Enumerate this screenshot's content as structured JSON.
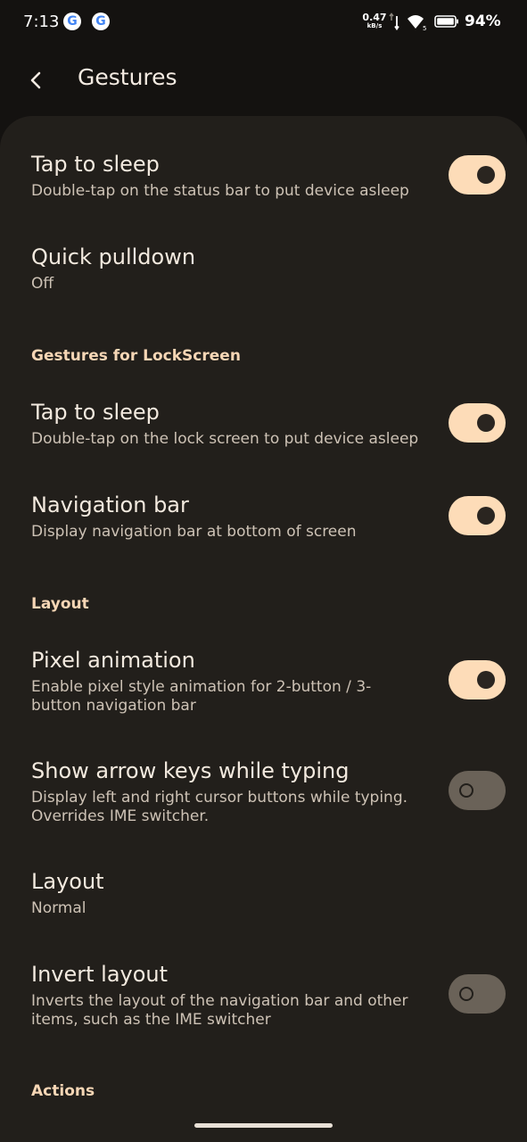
{
  "status_bar": {
    "time": "7:13",
    "notification_icons": [
      "google-g-icon",
      "google-g-icon"
    ],
    "g_letter": "G",
    "net_speed_value": "0.47",
    "net_speed_unit": "kB/s",
    "battery_percent": "94%"
  },
  "app_bar": {
    "title": "Gestures",
    "back_icon": "chevron-left-icon"
  },
  "settings": {
    "tap_to_sleep": {
      "title": "Tap to sleep",
      "summary": "Double-tap on the status bar to put device asleep",
      "enabled": true
    },
    "quick_pulldown": {
      "title": "Quick pulldown",
      "summary": "Off"
    },
    "lockscreen_header": "Gestures for LockScreen",
    "lock_tap_to_sleep": {
      "title": "Tap to sleep",
      "summary": "Double-tap on the lock screen to put device asleep",
      "enabled": true
    },
    "navigation_bar": {
      "title": "Navigation bar",
      "summary": "Display navigation bar at bottom of screen",
      "enabled": true
    },
    "layout_header": "Layout",
    "pixel_animation": {
      "title": "Pixel animation",
      "summary": "Enable pixel style animation for 2-button / 3-button navigation bar",
      "enabled": true
    },
    "arrow_keys": {
      "title": "Show arrow keys while typing",
      "summary": "Display left and right cursor buttons while typing. Overrides IME switcher.",
      "enabled": false
    },
    "layout": {
      "title": "Layout",
      "summary": "Normal"
    },
    "invert_layout": {
      "title": "Invert layout",
      "summary": "Inverts the layout of the navigation bar and other items, such as the IME switcher",
      "enabled": false
    },
    "actions_header": "Actions"
  },
  "colors": {
    "background": "#141210",
    "surface": "#221f1b",
    "accent": "#f6d6b5",
    "toggle_on": "#fddcb8",
    "toggle_off": "#6a6258"
  }
}
